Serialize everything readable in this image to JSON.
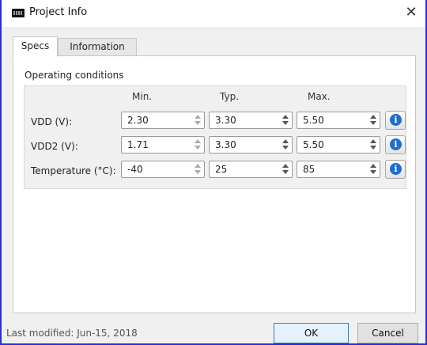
{
  "window": {
    "title": "Project Info",
    "close_glyph": "✕"
  },
  "tabs": [
    {
      "label": "Specs",
      "active": true
    },
    {
      "label": "Information",
      "active": false
    }
  ],
  "operating_conditions": {
    "title": "Operating conditions",
    "columns": {
      "min": "Min.",
      "typ": "Typ.",
      "max": "Max."
    },
    "rows": [
      {
        "label": "VDD (V):",
        "min": "2.30",
        "typ": "3.30",
        "max": "5.50",
        "info_icon": "info-icon"
      },
      {
        "label": "VDD2 (V):",
        "min": "1.71",
        "typ": "3.30",
        "max": "5.50",
        "info_icon": "info-icon"
      },
      {
        "label": "Temperature (°C):",
        "min": "-40",
        "typ": "25",
        "max": "85",
        "info_icon": "info-icon"
      }
    ]
  },
  "status": {
    "last_modified": "Last modified: Jun-15, 2018"
  },
  "buttons": {
    "ok": "OK",
    "cancel": "Cancel"
  },
  "colors": {
    "window_border": "#2a2fd6",
    "info_icon": "#1b6fcf",
    "default_button_border": "#3c7fb1"
  }
}
